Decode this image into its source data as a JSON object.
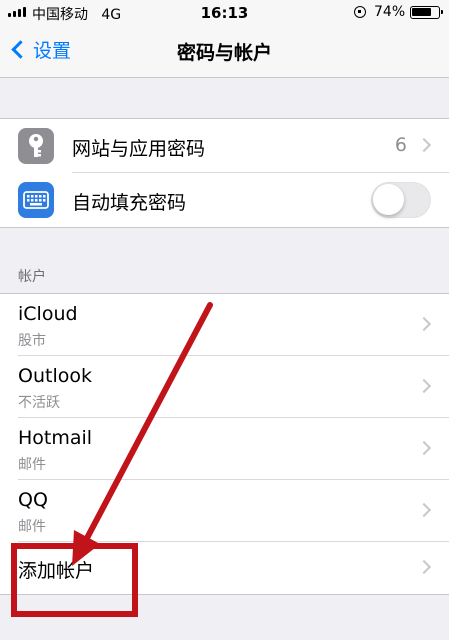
{
  "status_bar": {
    "carrier": "中国移动",
    "network": "4G",
    "time": "16:13",
    "battery": "74%"
  },
  "nav": {
    "back_label": "设置",
    "title": "密码与帐户"
  },
  "passwords_group": {
    "website_passwords": {
      "label": "网站与应用密码",
      "count": "6",
      "icon": "key-icon"
    },
    "autofill": {
      "label": "自动填充密码",
      "enabled": false,
      "icon": "keyboard-icon"
    }
  },
  "accounts": {
    "header": "帐户",
    "items": [
      {
        "name": "iCloud",
        "detail": "股市"
      },
      {
        "name": "Outlook",
        "detail": "不活跃"
      },
      {
        "name": "Hotmail",
        "detail": "邮件"
      },
      {
        "name": "QQ",
        "detail": "邮件"
      }
    ],
    "add_label": "添加帐户"
  },
  "colors": {
    "accent": "#007aff",
    "annotation": "#c0141a",
    "key_icon_bg": "#8e8e93",
    "keyboard_icon_bg": "#2f7de1"
  }
}
